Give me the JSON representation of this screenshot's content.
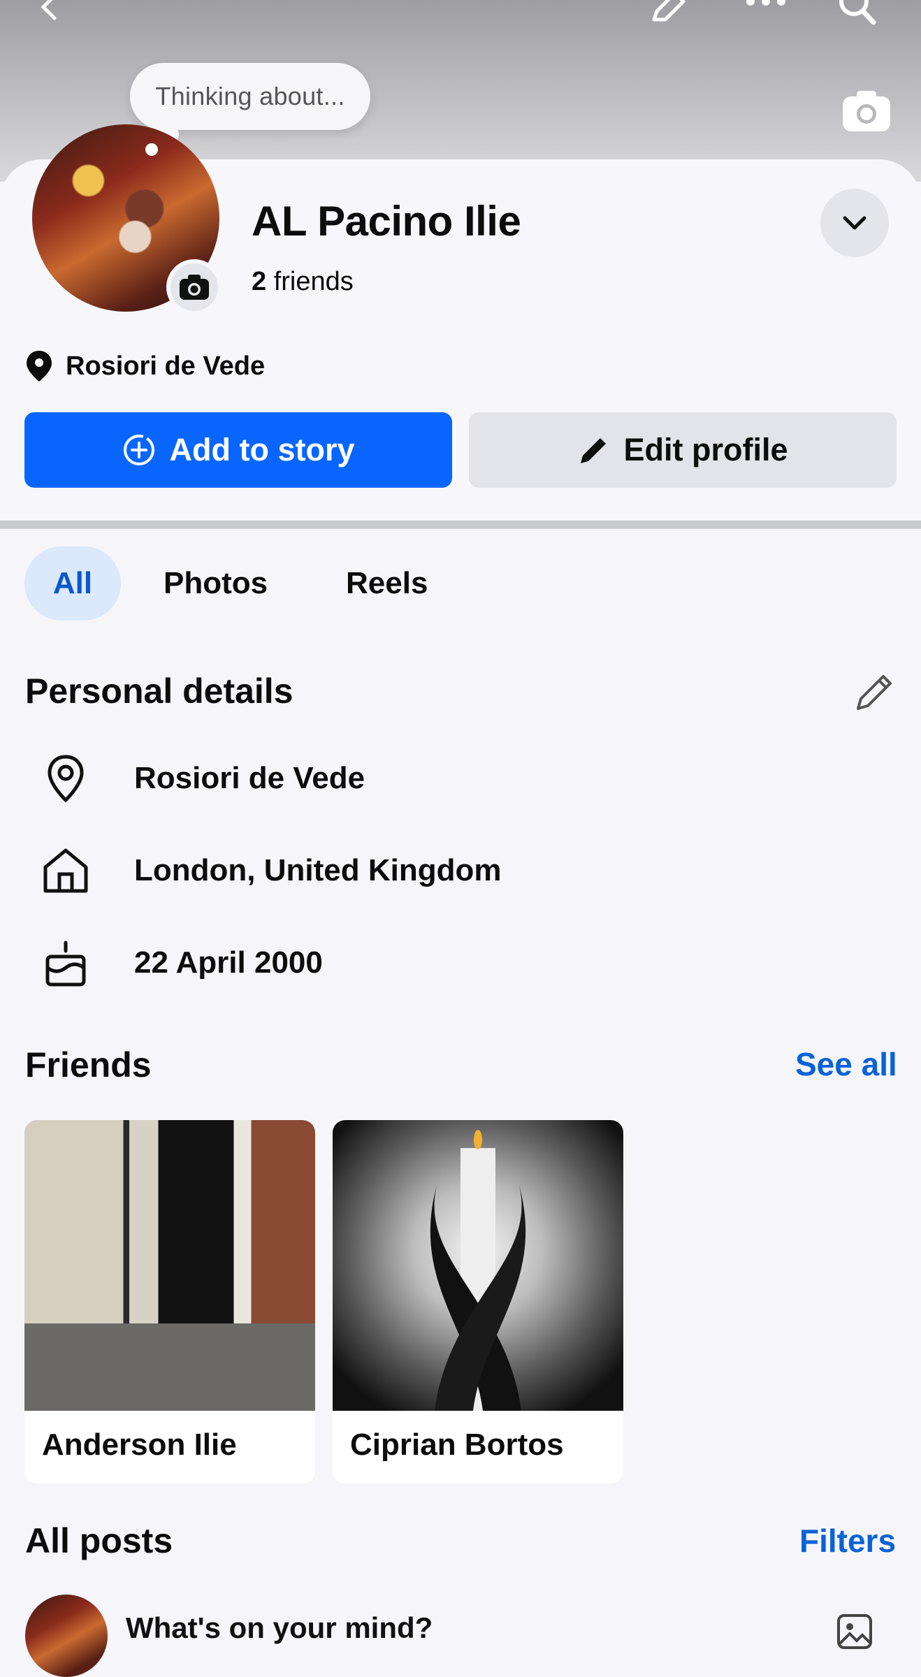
{
  "header": {
    "thinking_bubble": "Thinking about..."
  },
  "profile": {
    "name": "AL Pacino Ilie",
    "friends_count": "2",
    "friends_label": "friends",
    "location": "Rosiori de Vede"
  },
  "actions": {
    "add_story": "Add to story",
    "edit_profile": "Edit profile"
  },
  "tabs": [
    {
      "label": "All",
      "active": true
    },
    {
      "label": "Photos",
      "active": false
    },
    {
      "label": "Reels",
      "active": false
    }
  ],
  "personal_details": {
    "title": "Personal details",
    "items": [
      {
        "icon": "location-pin-icon",
        "text": "Rosiori de Vede"
      },
      {
        "icon": "home-icon",
        "text": "London, United Kingdom"
      },
      {
        "icon": "birthday-cake-icon",
        "text": "22 April 2000"
      }
    ]
  },
  "friends_section": {
    "title": "Friends",
    "see_all": "See all",
    "friends": [
      {
        "name": "Anderson Ilie"
      },
      {
        "name": "Ciprian Bortos"
      }
    ]
  },
  "posts": {
    "title": "All posts",
    "filters": "Filters",
    "composer_placeholder": "What's on your mind?"
  },
  "colors": {
    "primary": "#0866ff",
    "link": "#0a62d6",
    "tab_active_bg": "#dce8fb",
    "secondary_button": "#e3e4e9"
  }
}
